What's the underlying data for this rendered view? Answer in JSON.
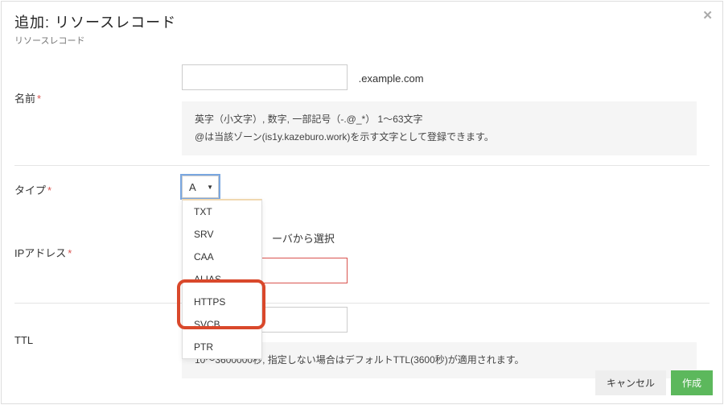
{
  "header": {
    "title": "追加: リソースレコード",
    "subtitle": "リソースレコード",
    "close": "✕"
  },
  "form": {
    "name": {
      "label": "名前",
      "required": "*",
      "value": "",
      "suffix": ".example.com",
      "help1": "英字（小文字）, 数字, 一部記号（-.@_*） 1〜63文字",
      "help2": "@は当該ゾーン(is1y.kazeburo.work)を示す文字として登録できます。"
    },
    "type": {
      "label": "タイプ",
      "required": "*",
      "selected": "A",
      "options": [
        "TXT",
        "SRV",
        "CAA",
        "ALIAS",
        "HTTPS",
        "SVCB",
        "PTR"
      ]
    },
    "ip": {
      "label": "IPアドレス",
      "required": "*",
      "serverSelect": "ーバから選択",
      "value": ""
    },
    "ttl": {
      "label": "TTL",
      "value": "",
      "help": "10〜3600000秒, 指定しない場合はデフォルトTTL(3600秒)が適用されます。"
    }
  },
  "footer": {
    "cancel": "キャンセル",
    "create": "作成"
  }
}
